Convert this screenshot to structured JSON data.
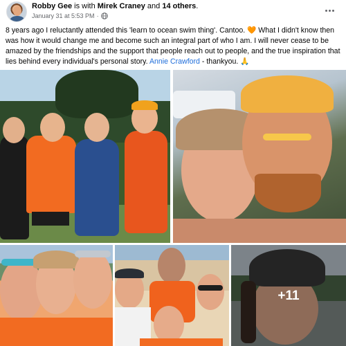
{
  "header": {
    "author_name": "Robby Gee",
    "with_text": " is with ",
    "tagged_name": "Mirek Craney",
    "and_text": " and ",
    "others_text": "14 others",
    "period": ".",
    "timestamp": "January 31 at 5:53 PM",
    "separator": "·",
    "privacy_icon": "globe-icon",
    "more_icon": "more-options-icon"
  },
  "post": {
    "text_before_heart": "8 years ago I reluctantly attended this 'learn to ocean swim thing'. Cantoo. ",
    "heart_emoji": "🧡",
    "text_after_heart": " What I didn't know then was how it would change me and become such an integral part of who I am. I will never cease to be amazed by the friendships and the support that people reach out to people, and the true inspiration that lies behind every individual's personal story. ",
    "mention": "Annie Crawford",
    "text_end": " - thankyou. ",
    "pray_emoji": "🙏"
  },
  "photos": {
    "overlay_count": "+11"
  },
  "colors": {
    "link": "#216fdb",
    "meta": "#65676b",
    "text": "#050505",
    "swim_orange": "#f26b21"
  }
}
